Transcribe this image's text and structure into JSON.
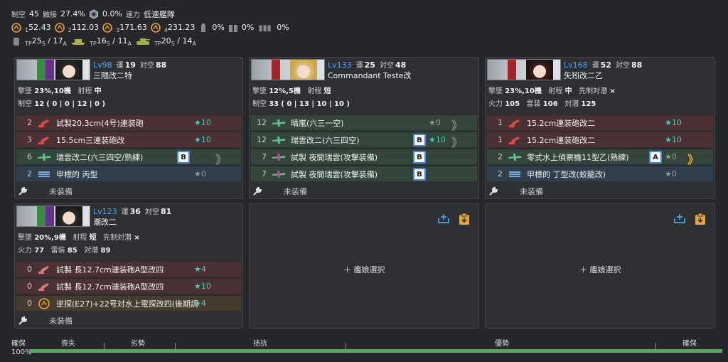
{
  "summary": {
    "air_superiority_label": "制空",
    "air_superiority_value": "45",
    "contact_label": "触接",
    "contact_value": "27.4%",
    "plane_rate": "0.0%",
    "speed_label": "速力",
    "speed_value": "低速艦隊",
    "los": [
      {
        "sub": "1",
        "value": "52.43"
      },
      {
        "sub": "2",
        "value": "112.03"
      },
      {
        "sub": "3",
        "value": "171.63"
      },
      {
        "sub": "4",
        "value": "231.23"
      }
    ],
    "drum_rates": [
      "0%",
      "0%",
      "0%"
    ],
    "tp": [
      {
        "s": "25",
        "a": "17"
      },
      {
        "s": "16",
        "a": "11"
      },
      {
        "s": "20",
        "a": "14"
      }
    ],
    "tp_label": "TP",
    "s_sub": "S",
    "a_sub": "A"
  },
  "ships": [
    {
      "lv": "Lv98",
      "luck_label": "運",
      "luck": "19",
      "aa_label": "対空",
      "aa": "88",
      "name": "三隈改二特",
      "line1": {
        "label": "撃墜",
        "value": "23%,10機",
        "range_label": "射程",
        "range": "中"
      },
      "line2": {
        "label": "制空",
        "value": "12",
        "extra": "( 0 | 0 | 12 | 0 )"
      },
      "slots": [
        {
          "cnt": "2",
          "name": "試製20.3cm(4号)連装砲",
          "star": "★10",
          "color": "red"
        },
        {
          "cnt": "3",
          "name": "15.5cm三連装砲改",
          "star": "★10",
          "color": "red"
        },
        {
          "cnt": "6",
          "name": "瑞雲改二(六三四空/熟練)",
          "prof": "B",
          "chev": "》",
          "color": "green"
        },
        {
          "cnt": "2",
          "name": "甲標的 丙型",
          "star": "★0",
          "color": "blue"
        }
      ],
      "empty": "未装備"
    },
    {
      "lv": "Lv133",
      "luck_label": "運",
      "luck": "25",
      "aa_label": "対空",
      "aa": "48",
      "name": "Commandant Teste改",
      "line1": {
        "label": "撃墜",
        "value": "12%,5機",
        "range_label": "射程",
        "range": "短"
      },
      "line2": {
        "label": "制空",
        "value": "33",
        "extra": "( 0 | 13 | 10 | 10 )"
      },
      "slots": [
        {
          "cnt": "12",
          "name": "晴嵐(六三一空)",
          "star": "★0",
          "chev": "》",
          "color": "green"
        },
        {
          "cnt": "12",
          "name": "瑞雲改二(六三四空)",
          "prof": "B",
          "star": "★10",
          "chev": "》",
          "color": "green"
        },
        {
          "cnt": "7",
          "name": "試製 夜間瑞雲(攻撃装備)",
          "prof": "B",
          "color": "green"
        },
        {
          "cnt": "7",
          "name": "試製 夜間瑞雲(攻撃装備)",
          "prof": "B",
          "color": "green"
        }
      ],
      "empty": "未装備"
    },
    {
      "lv": "Lv168",
      "luck_label": "運",
      "luck": "52",
      "aa_label": "対空",
      "aa": "88",
      "name": "矢矧改二乙",
      "line1": {
        "label": "撃墜",
        "value": "23%,10機",
        "range_label": "射程",
        "range": "中",
        "asw_label": "先制対潜",
        "asw": "×"
      },
      "line2": {
        "fp_label": "火力",
        "fp": "105",
        "tp_label": "雷装",
        "tp": "106",
        "as_label": "対潜",
        "as": "125"
      },
      "slots": [
        {
          "cnt": "1",
          "name": "15.2cm連装砲改二",
          "star": "★10",
          "color": "red"
        },
        {
          "cnt": "1",
          "name": "15.2cm連装砲改二",
          "star": "★10",
          "color": "red"
        },
        {
          "cnt": "2",
          "name": "零式水上偵察機11型乙(熟練)",
          "prof": "A",
          "star": "★0",
          "chev": "》",
          "color": "green"
        },
        {
          "cnt": "2",
          "name": "甲標的 丁型改(蛟龍改)",
          "star": "★0",
          "color": "blue"
        }
      ],
      "empty": "未装備"
    },
    {
      "lv": "Lv123",
      "luck_label": "運",
      "luck": "36",
      "aa_label": "対空",
      "aa": "81",
      "name": "潮改二",
      "line1": {
        "label": "撃墜",
        "value": "20%,9機",
        "range_label": "射程",
        "range": "短",
        "asw_label": "先制対潜",
        "asw": "×"
      },
      "line2": {
        "fp_label": "火力",
        "fp": "77",
        "tp_label": "雷装",
        "tp": "85",
        "as_label": "対潜",
        "as": "89"
      },
      "slots": [
        {
          "cnt": "0",
          "name": "試製 長12.7cm連装砲A型改四",
          "star": "★4",
          "color": "red"
        },
        {
          "cnt": "0",
          "name": "試製 長12.7cm連装砲A型改四",
          "star": "★10",
          "color": "red"
        },
        {
          "cnt": "0",
          "name": "逆探(E27)+22号対水上電探改四(後期調整",
          "star": "★4",
          "color": "amber"
        }
      ],
      "empty": "未装備"
    }
  ],
  "empty_slot_label": "＋ 艦娘選択",
  "gauge": {
    "label_left": "確保",
    "percent": "100%",
    "fill_fraction": 1.0,
    "segments": [
      "喪失",
      "劣勢",
      "拮抗",
      "優勢",
      "確保"
    ]
  }
}
